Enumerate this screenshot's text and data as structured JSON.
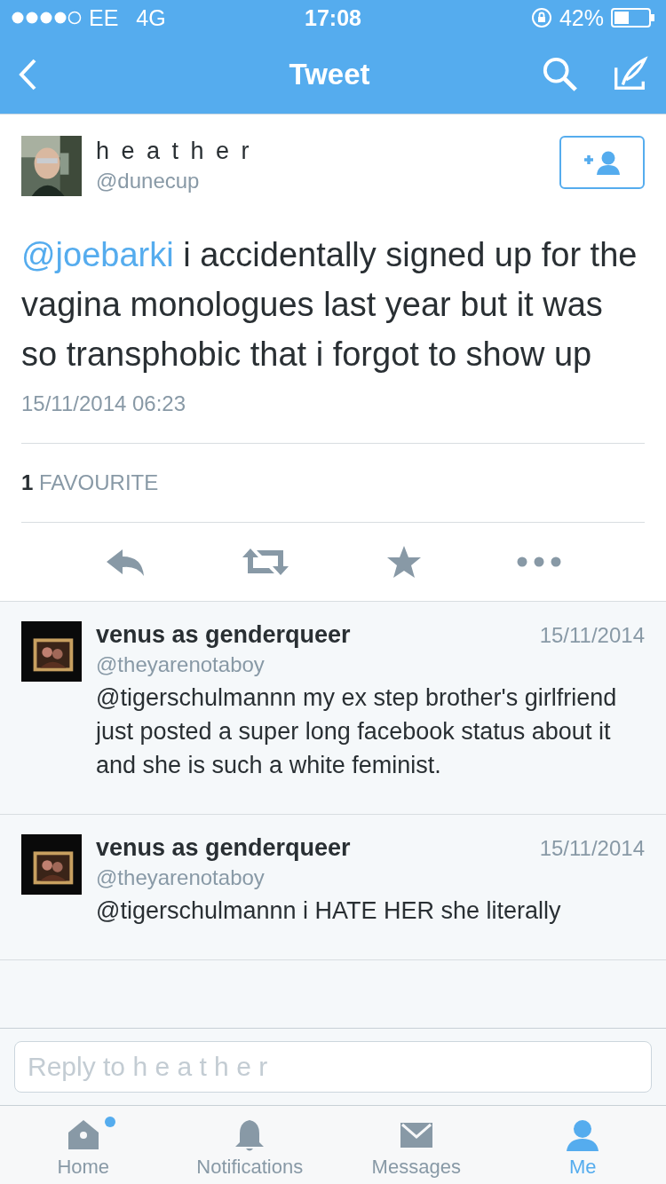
{
  "status_bar": {
    "carrier": "EE",
    "network": "4G",
    "time": "17:08",
    "battery": "42%"
  },
  "nav": {
    "title": "Tweet"
  },
  "tweet": {
    "name": "h e a t h e r",
    "handle": "@dunecup",
    "mention": "@joebarki",
    "text": " i accidentally signed up for the vagina monologues last year but it was so transphobic that i forgot to show up",
    "date": "15/11/2014 06:23",
    "favourites_count": "1",
    "favourites_label": "FAVOURITE"
  },
  "replies": [
    {
      "name": "venus as genderqueer",
      "handle": "@theyarenotaboy",
      "date": "15/11/2014",
      "text": "@tigerschulmannn my ex step brother's girlfriend just posted a super long facebook status about it and she is such a white feminist."
    },
    {
      "name": "venus as genderqueer",
      "handle": "@theyarenotaboy",
      "date": "15/11/2014",
      "text": "@tigerschulmannn i HATE HER she literally"
    }
  ],
  "reply_box": {
    "placeholder": "Reply to h e a t h e r"
  },
  "tabs": [
    {
      "label": "Home",
      "selected": false,
      "dot": true
    },
    {
      "label": "Notifications",
      "selected": false,
      "dot": false
    },
    {
      "label": "Messages",
      "selected": false,
      "dot": false
    },
    {
      "label": "Me",
      "selected": true,
      "dot": false
    }
  ]
}
